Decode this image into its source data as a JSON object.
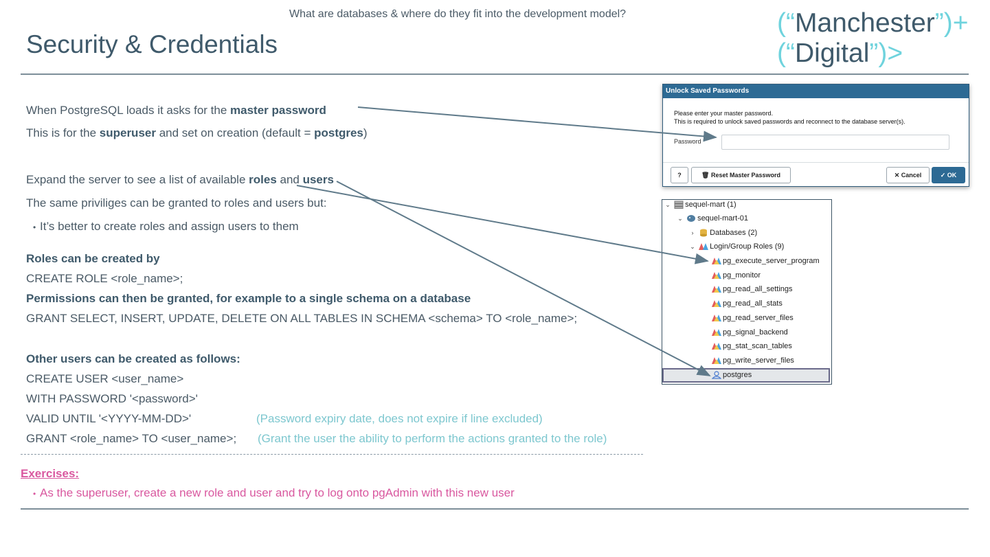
{
  "header": {
    "subtitle": "What are databases & where do they fit into the development model?",
    "title": "Security & Credentials",
    "brand_line1_open": "(“",
    "brand_line1_word": "Manchester",
    "brand_line1_close": "”)+",
    "brand_line2_open": "(“",
    "brand_line2_word": "Digital",
    "brand_line2_close": "”)>"
  },
  "content": {
    "l1_pre": "When PostgreSQL loads it asks for the ",
    "l1_bold": "master password",
    "l2_pre": "This is for the ",
    "l2_bold": "superuser",
    "l2_mid": " and set on creation (default = ",
    "l2_bold2": "postgres",
    "l2_post": ")",
    "l3_pre": "Expand the server to see a list of available ",
    "l3_bold": "roles",
    "l3_mid": " and ",
    "l3_bold2": "users",
    "l4": "The same priviliges can be granted to roles and users but:",
    "bullet1": "It’s better to create roles and assign users to them",
    "h1": "Roles can be created by",
    "code1": "CREATE ROLE <role_name>;",
    "h2": "Permissions can then be granted, for example to a single schema on a database",
    "code2": "GRANT SELECT, INSERT, UPDATE, DELETE ON ALL TABLES IN SCHEMA <schema> TO <role_name>;",
    "h3": "Other users can be created as follows:",
    "code3": "CREATE USER <user_name>",
    "code4": "WITH PASSWORD '<password>'",
    "code5": "VALID UNTIL '<YYYY-MM-DD>'",
    "note5": "(Password expiry date, does not expire if line excluded)",
    "code6": "GRANT <role_name> TO <user_name>;",
    "note6": "(Grant the user the ability to perform the actions granted to the role)"
  },
  "exercises": {
    "heading": "Exercises:",
    "item1": "As the superuser, create a new role and user and try to log onto pgAdmin with this new user"
  },
  "dialog": {
    "title": "Unlock Saved Passwords",
    "msg1": "Please enter your master password.",
    "msg2": "This is required to unlock saved passwords and reconnect to the database server(s).",
    "password_label": "Password",
    "password_value": "",
    "help_label": "?",
    "reset_label": "Reset Master Password",
    "cancel_label": "Cancel",
    "ok_label": "OK"
  },
  "tree": {
    "group": "sequel-mart (1)",
    "server": "sequel-mart-01",
    "databases": "Databases (2)",
    "roles": "Login/Group Roles (9)",
    "role_items": [
      "pg_execute_server_program",
      "pg_monitor",
      "pg_read_all_settings",
      "pg_read_all_stats",
      "pg_read_server_files",
      "pg_signal_backend",
      "pg_stat_scan_tables",
      "pg_write_server_files",
      "postgres"
    ]
  },
  "colors": {
    "accent": "#6fd3dd",
    "title": "#3f5a6b",
    "exercise": "#d9589f",
    "dialog_header": "#2d6a94",
    "arrow": "#5f7a8a"
  },
  "icons": {
    "server_group": "server-group-icon",
    "server": "elephant-icon",
    "databases": "database-icon",
    "roles": "group-roles-icon",
    "role": "role-icon",
    "user": "user-icon",
    "trash": "trash-icon"
  }
}
